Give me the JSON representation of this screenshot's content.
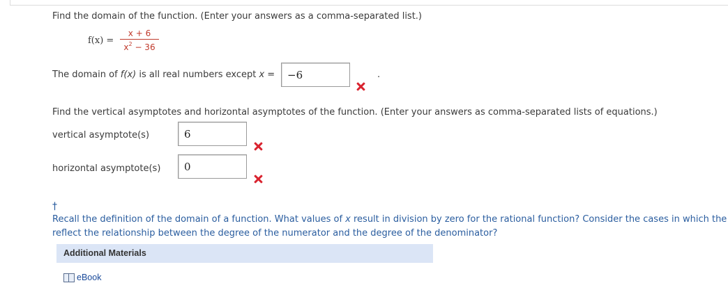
{
  "q1": {
    "instruction": "Find the domain of the function. (Enter your answers as a comma-separated list.)",
    "function_label": "f(x) =",
    "numerator": "x + 6",
    "denominator_base": "x",
    "denominator_exp": "2",
    "denominator_rest": " − 36",
    "domain_text_prefix": "The domain of ",
    "domain_fx": "f(x)",
    "domain_text_mid": " is all real numbers except ",
    "domain_var": "x",
    "domain_eq": " =",
    "domain_answer": "−6",
    "trailing_period": "."
  },
  "q2": {
    "instruction": "Find the vertical asymptotes and horizontal asymptotes of the function. (Enter your answers as comma-separated lists of equations.)",
    "vertical_label": "vertical asymptote(s)",
    "vertical_answer": "6",
    "horizontal_label": "horizontal asymptote(s)",
    "horizontal_answer": "0"
  },
  "hint": {
    "dagger": "†",
    "line1_a": "Recall the definition of the domain of a function. What values of ",
    "line1_var": "x",
    "line1_b": " result in division by zero for the rational function? Consider the cases in which the",
    "line2": "reflect the relationship between the degree of the numerator and the degree of the denominator?"
  },
  "materials": {
    "title": "Additional Materials",
    "ebook": "eBook"
  },
  "colors": {
    "incorrect": "#d9232f",
    "hint_text": "#2a5d9f",
    "materials_bg": "#dbe5f6"
  },
  "icons": [
    "incorrect-x-icon",
    "book-icon"
  ]
}
